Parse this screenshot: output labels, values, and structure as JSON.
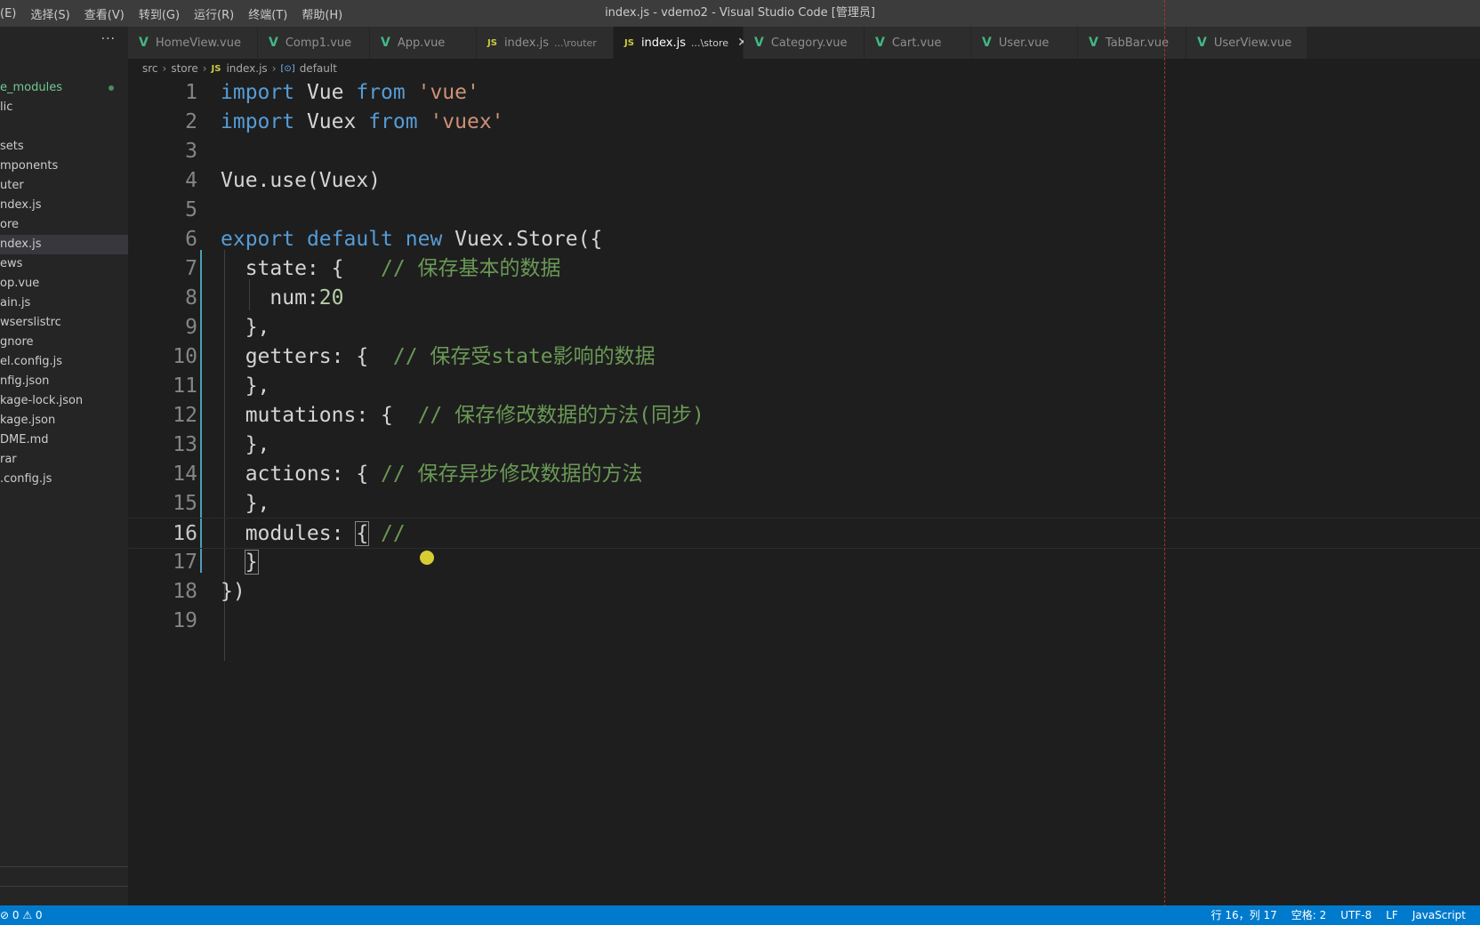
{
  "window": {
    "title": "index.js - vdemo2 - Visual Studio Code [管理员]"
  },
  "menu": [
    "(E)",
    "选择(S)",
    "查看(V)",
    "转到(G)",
    "运行(R)",
    "终端(T)",
    "帮助(H)"
  ],
  "sidebar": {
    "more_label": "···",
    "items": [
      {
        "label": "e_modules",
        "modified": true
      },
      {
        "label": "lic"
      },
      {
        "label": ""
      },
      {
        "label": "sets"
      },
      {
        "label": "mponents"
      },
      {
        "label": "uter"
      },
      {
        "label": "ndex.js"
      },
      {
        "label": "ore"
      },
      {
        "label": "ndex.js",
        "selected": true
      },
      {
        "label": "ews"
      },
      {
        "label": "op.vue"
      },
      {
        "label": "ain.js"
      },
      {
        "label": "wserslistrc"
      },
      {
        "label": "gnore"
      },
      {
        "label": "el.config.js"
      },
      {
        "label": "nfig.json"
      },
      {
        "label": "kage-lock.json"
      },
      {
        "label": "kage.json"
      },
      {
        "label": "DME.md"
      },
      {
        "label": "rar"
      },
      {
        "label": ".config.js"
      }
    ]
  },
  "tabs": [
    {
      "label": "HomeView.vue",
      "icon": "vue-icon",
      "width": 146
    },
    {
      "label": "Comp1.vue",
      "icon": "vue-icon",
      "width": 126
    },
    {
      "label": "App.vue",
      "icon": "vue-icon",
      "width": 120
    },
    {
      "label": "index.js",
      "desc": "...\\router",
      "icon": "js-icon",
      "width": 154
    },
    {
      "label": "index.js",
      "desc": "...\\store",
      "icon": "js-icon",
      "active": true,
      "close": "✕",
      "width": 146
    },
    {
      "label": "Category.vue",
      "icon": "vue-icon",
      "width": 136
    },
    {
      "label": "Cart.vue",
      "icon": "vue-icon",
      "width": 120
    },
    {
      "label": "User.vue",
      "icon": "vue-icon",
      "width": 120
    },
    {
      "label": "TabBar.vue",
      "icon": "vue-icon",
      "width": 122
    },
    {
      "label": "UserView.vue",
      "icon": "vue-icon",
      "width": 136
    }
  ],
  "breadcrumb": {
    "parts": [
      "src",
      "store",
      "index.js",
      "default"
    ],
    "js_badge": "JS"
  },
  "editor": {
    "current_line": 16,
    "lines": [
      [
        [
          "kw",
          "import"
        ],
        [
          "p",
          " Vue "
        ],
        [
          "kw",
          "from"
        ],
        [
          "p",
          " "
        ],
        [
          "str",
          "'vue'"
        ]
      ],
      [
        [
          "kw",
          "import"
        ],
        [
          "p",
          " Vuex "
        ],
        [
          "kw",
          "from"
        ],
        [
          "p",
          " "
        ],
        [
          "str",
          "'vuex'"
        ]
      ],
      [],
      [
        [
          "p",
          "Vue.use(Vuex)"
        ]
      ],
      [],
      [
        [
          "kw",
          "export"
        ],
        [
          "p",
          " "
        ],
        [
          "kw",
          "default"
        ],
        [
          "p",
          " "
        ],
        [
          "kw",
          "new"
        ],
        [
          "p",
          " Vuex.Store({"
        ]
      ],
      [
        [
          "p",
          "  state: {   "
        ],
        [
          "cm",
          "// 保存基本的数据"
        ]
      ],
      [
        [
          "p",
          "    num:"
        ],
        [
          "num",
          "20"
        ]
      ],
      [
        [
          "p",
          "  },"
        ]
      ],
      [
        [
          "p",
          "  getters: {  "
        ],
        [
          "cm",
          "// 保存受state影响的数据"
        ]
      ],
      [
        [
          "p",
          "  },"
        ]
      ],
      [
        [
          "p",
          "  mutations: {  "
        ],
        [
          "cm",
          "// 保存修改数据的方法(同步)"
        ]
      ],
      [
        [
          "p",
          "  },"
        ]
      ],
      [
        [
          "p",
          "  actions: { "
        ],
        [
          "cm",
          "// 保存异步修改数据的方法"
        ]
      ],
      [
        [
          "p",
          "  },"
        ]
      ],
      [
        [
          "p",
          "  modules: "
        ],
        [
          "br",
          "{"
        ],
        [
          "p",
          " "
        ],
        [
          "cm",
          "//"
        ]
      ],
      [
        [
          "p",
          "  "
        ],
        [
          "br",
          "}"
        ]
      ],
      [
        [
          "p",
          "})"
        ]
      ],
      []
    ]
  },
  "statusbar": {
    "left": "⊘ 0 ⚠ 0",
    "right": [
      "行 16，列 17",
      "空格: 2",
      "UTF-8",
      "LF",
      "JavaScript"
    ]
  },
  "colors": {
    "statusbar": "#007acc",
    "accent_guide": "#4aa0b8",
    "vue": "#41b883",
    "js": "#cbcb41"
  }
}
